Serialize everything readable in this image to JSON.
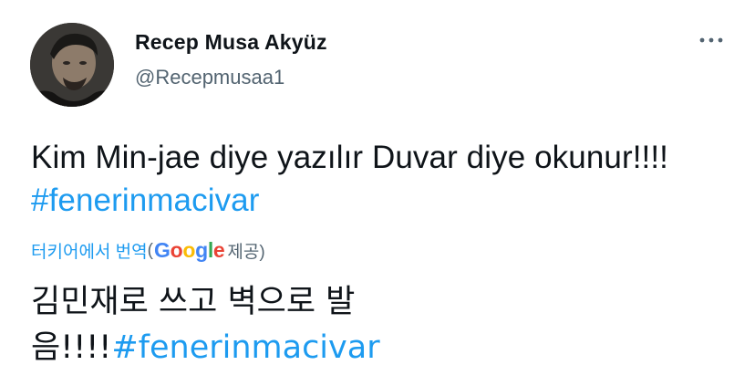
{
  "author": {
    "display_name": "Recep Musa Akyüz",
    "handle": "@Recepmusaa1",
    "avatar_icon": "user-photo-avatar"
  },
  "menu": {
    "icon": "more-horizontal-icon"
  },
  "tweet": {
    "text": "Kim Min-jae diye yazılır Duvar diye okunur!!!! ",
    "hashtag": "#fenerinmacivar"
  },
  "translation": {
    "label": "터키어에서 번역",
    "paren_open": "(",
    "provider_logo": {
      "g1": "G",
      "o1": "o",
      "o2": "o",
      "g2": "g",
      "l": "l",
      "e": "e"
    },
    "provider_suffix": " 제공)",
    "text": "김민재로 쓰고 벽으로 발음!!!!",
    "hashtag": "#fenerinmacivar"
  },
  "colors": {
    "link": "#1d9bf0",
    "secondary_text": "#536471",
    "primary_text": "#0f1419"
  }
}
